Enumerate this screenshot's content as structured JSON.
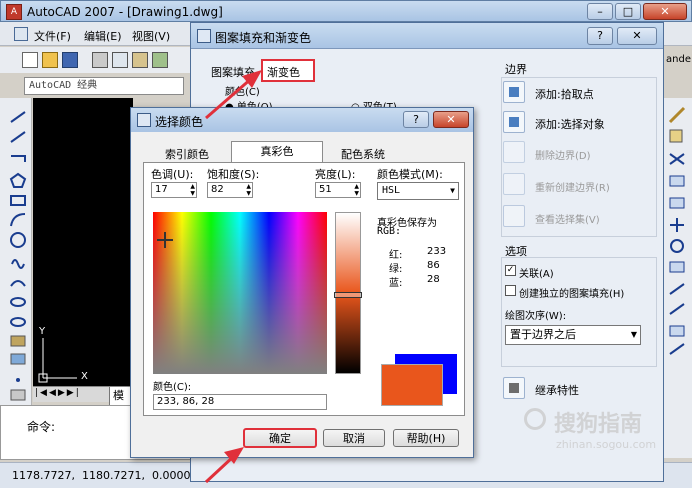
{
  "autocad": {
    "title": "AutoCAD 2007 - [Drawing1.dwg]",
    "menus": [
      "文件(F)",
      "编辑(E)",
      "视图(V)"
    ],
    "workspace": "AutoCAD 经典",
    "command_label": "命令:",
    "coords": "1178.7727,  1180.7271,  0.0000",
    "model_tab": "模型",
    "ucs_x": "X",
    "ucs_y": "Y",
    "right_edge_text": "ande"
  },
  "hatch_dialog": {
    "title": "图案填充和渐变色",
    "tabs": [
      "图案填充",
      "渐变色"
    ],
    "color_label": "颜色(C)",
    "single_color": "单色(O)",
    "two_color": "双色(T)",
    "boundary_title": "边界",
    "boundary_items": [
      {
        "label": "添加:拾取点",
        "enabled": true
      },
      {
        "label": "添加:选择对象",
        "enabled": true
      },
      {
        "label": "删除边界(D)",
        "enabled": false
      },
      {
        "label": "重新创建边界(R)",
        "enabled": false
      },
      {
        "label": "查看选择集(V)",
        "enabled": false
      }
    ],
    "options_title": "选项",
    "assoc_label": "关联(A)",
    "independent_label": "创建独立的图案填充(H)",
    "draw_order_label": "绘图次序(W):",
    "draw_order_value": "置于边界之后",
    "inherit_label": "继承特性"
  },
  "color_dialog": {
    "title": "选择颜色",
    "tabs": [
      "索引颜色",
      "真彩色",
      "配色系统"
    ],
    "hue_label": "色调(U):",
    "hue_value": "17",
    "sat_label": "饱和度(S):",
    "sat_value": "82",
    "lum_label": "亮度(L):",
    "lum_value": "51",
    "mode_label": "颜色模式(M):",
    "mode_value": "HSL",
    "save_as_label": "真彩色保存为",
    "rgb_label": "RGB:",
    "rgb_rows": [
      {
        "name": "红:",
        "value": "233"
      },
      {
        "name": "绿:",
        "value": "86"
      },
      {
        "name": "蓝:",
        "value": "28"
      }
    ],
    "color_label": "颜色(C):",
    "color_value": "233, 86, 28",
    "ok": "确定",
    "cancel": "取消",
    "help": "帮助(H)",
    "new_color": "#e9561c",
    "old_color": "#0000ff",
    "luminance": 0.51
  },
  "watermark": {
    "name": "搜狗指南",
    "url": "zhinan.sogou.com"
  },
  "colors": {
    "highlight": "#e0303a"
  }
}
